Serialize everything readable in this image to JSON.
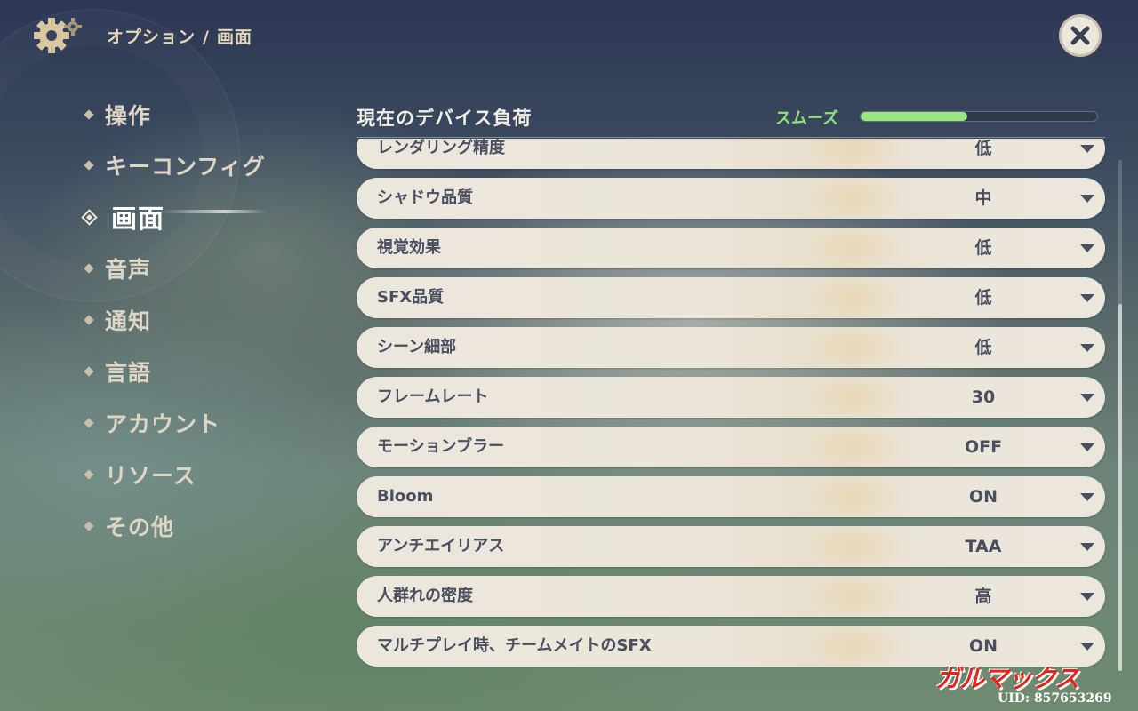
{
  "header": {
    "breadcrumb_parent": "オプション",
    "breadcrumb_separator": "/",
    "breadcrumb_current": "画面",
    "icon": "gear-icon",
    "close_icon": "close-icon"
  },
  "sidebar": {
    "items": [
      {
        "label": "操作",
        "active": false
      },
      {
        "label": "キーコンフィグ",
        "active": false
      },
      {
        "label": "画面",
        "active": true
      },
      {
        "label": "音声",
        "active": false
      },
      {
        "label": "通知",
        "active": false
      },
      {
        "label": "言語",
        "active": false
      },
      {
        "label": "アカウント",
        "active": false
      },
      {
        "label": "リソース",
        "active": false
      },
      {
        "label": "その他",
        "active": false
      }
    ]
  },
  "device_load": {
    "title": "現在のデバイス負荷",
    "status": "スムーズ",
    "level_fraction": 0.45,
    "status_color": "#8fe07a"
  },
  "settings": [
    {
      "label": "レンダリング精度",
      "value": "低"
    },
    {
      "label": "シャドウ品質",
      "value": "中"
    },
    {
      "label": "視覚効果",
      "value": "低"
    },
    {
      "label": "SFX品質",
      "value": "低"
    },
    {
      "label": "シーン細部",
      "value": "低"
    },
    {
      "label": "フレームレート",
      "value": "30"
    },
    {
      "label": "モーションブラー",
      "value": "OFF"
    },
    {
      "label": "Bloom",
      "value": "ON"
    },
    {
      "label": "アンチエイリアス",
      "value": "TAA"
    },
    {
      "label": "人群れの密度",
      "value": "高"
    },
    {
      "label": "マルチプレイ時、チームメイトのSFX",
      "value": "ON"
    }
  ],
  "watermark": "ガルマックス",
  "uid": "UID: 857653269"
}
